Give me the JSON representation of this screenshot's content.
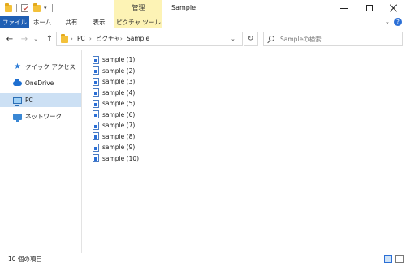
{
  "window": {
    "title": "Sample",
    "contextual_group": "管理"
  },
  "ribbon": {
    "tabs": [
      {
        "label": "ファイル"
      },
      {
        "label": "ホーム"
      },
      {
        "label": "共有"
      },
      {
        "label": "表示"
      },
      {
        "label": "ピクチャ ツール"
      }
    ],
    "help_label": "?"
  },
  "nav": {
    "back_glyph": "←",
    "forward_glyph": "→",
    "recent_glyph": "⌄",
    "up_glyph": "↑"
  },
  "address": {
    "crumbs": [
      "PC",
      "ピクチャ",
      "Sample"
    ],
    "separator": "›"
  },
  "search": {
    "placeholder": "Sampleの検索"
  },
  "sidebar": {
    "items": [
      {
        "label": "クイック アクセス"
      },
      {
        "label": "OneDrive"
      },
      {
        "label": "PC"
      },
      {
        "label": "ネットワーク"
      }
    ],
    "selected": "PC"
  },
  "files": [
    {
      "name": "sample (1)"
    },
    {
      "name": "sample (2)"
    },
    {
      "name": "sample (3)"
    },
    {
      "name": "sample (4)"
    },
    {
      "name": "sample (5)"
    },
    {
      "name": "sample (6)"
    },
    {
      "name": "sample (7)"
    },
    {
      "name": "sample (8)"
    },
    {
      "name": "sample (9)"
    },
    {
      "name": "sample (10)"
    }
  ],
  "status": {
    "item_count": "10 個の項目"
  },
  "colors": {
    "file_tab": "#1f5fb4",
    "contextual_tab": "#fdf3b5",
    "selected_sidebar": "#cce0f4"
  }
}
